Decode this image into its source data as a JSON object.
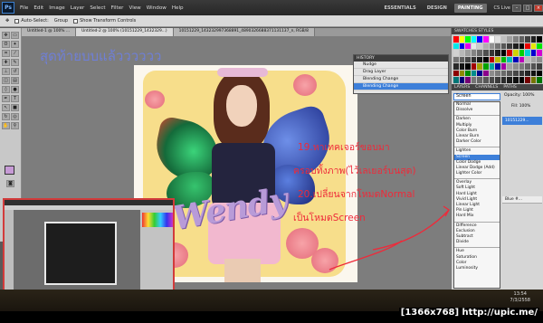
{
  "menubar": {
    "logo": "Ps",
    "items": [
      "File",
      "Edit",
      "Image",
      "Layer",
      "Select",
      "Filter",
      "View",
      "Window",
      "Help"
    ],
    "workspaces": [
      "ESSENTIALS",
      "DESIGN",
      "PAINTING"
    ],
    "active_workspace": "PAINTING",
    "cslive": "CS Live"
  },
  "options": {
    "auto_select": "Auto-Select:",
    "auto_select_value": "Group",
    "transform": "Show Transform Controls"
  },
  "tabs": [
    "Untitled-1 @ 100% ...",
    "Untitled-2 @ 100% (10151229_1432329...)",
    "10151229_143232997368891_4890326688371131137_n, RGB/8"
  ],
  "overlay": {
    "title": "สุดท้ายบบแล้วววววว",
    "note1": "19.หาเทคเจอร์ขอบมา",
    "note2": "ครอบทั้งภาพ(ไว้เลเยอร์บนสุด)",
    "note3": "20.เปลี่ยนจากโหมดNormal",
    "note4": "เป็นโหมดScreen"
  },
  "artwork": {
    "signature": "Wendy"
  },
  "history": {
    "title": "HISTORY",
    "items": [
      "Nudge",
      "Drag Layer",
      "Blending Change",
      "Blending Change"
    ],
    "selected_index": 3
  },
  "swatches": {
    "title": "SWATCHES  STYLES"
  },
  "layers": {
    "tabs": [
      "LAYERS",
      "CHANNELS",
      "PATHS"
    ],
    "blend_value": "Screen",
    "opacity_label": "Opacity: 100%",
    "fill_label": "Fill: 100%",
    "selected_layer": "10151229...",
    "other_layer": "Blue #..."
  },
  "blend_modes": [
    "Normal",
    "Dissolve",
    "-",
    "Darken",
    "Multiply",
    "Color Burn",
    "Linear Burn",
    "Darker Color",
    "-",
    "Lighten",
    "Screen",
    "Color Dodge",
    "Linear Dodge (Add)",
    "Lighter Color",
    "-",
    "Overlay",
    "Soft Light",
    "Hard Light",
    "Vivid Light",
    "Linear Light",
    "Pin Light",
    "Hard Mix",
    "-",
    "Difference",
    "Exclusion",
    "Subtract",
    "Divide",
    "-",
    "Hue",
    "Saturation",
    "Color",
    "Luminosity"
  ],
  "blend_selected": "Screen",
  "taskbar": {
    "time": "13:54",
    "date": "7/3/2558"
  },
  "watermark": "[1366x768] http://upic.me/",
  "colors": {
    "title_blue": "#6f7fd6",
    "note_red": "#ee2a3a",
    "selection_blue": "#3d7fd9",
    "foreground_swatch": "#c79bd6"
  }
}
